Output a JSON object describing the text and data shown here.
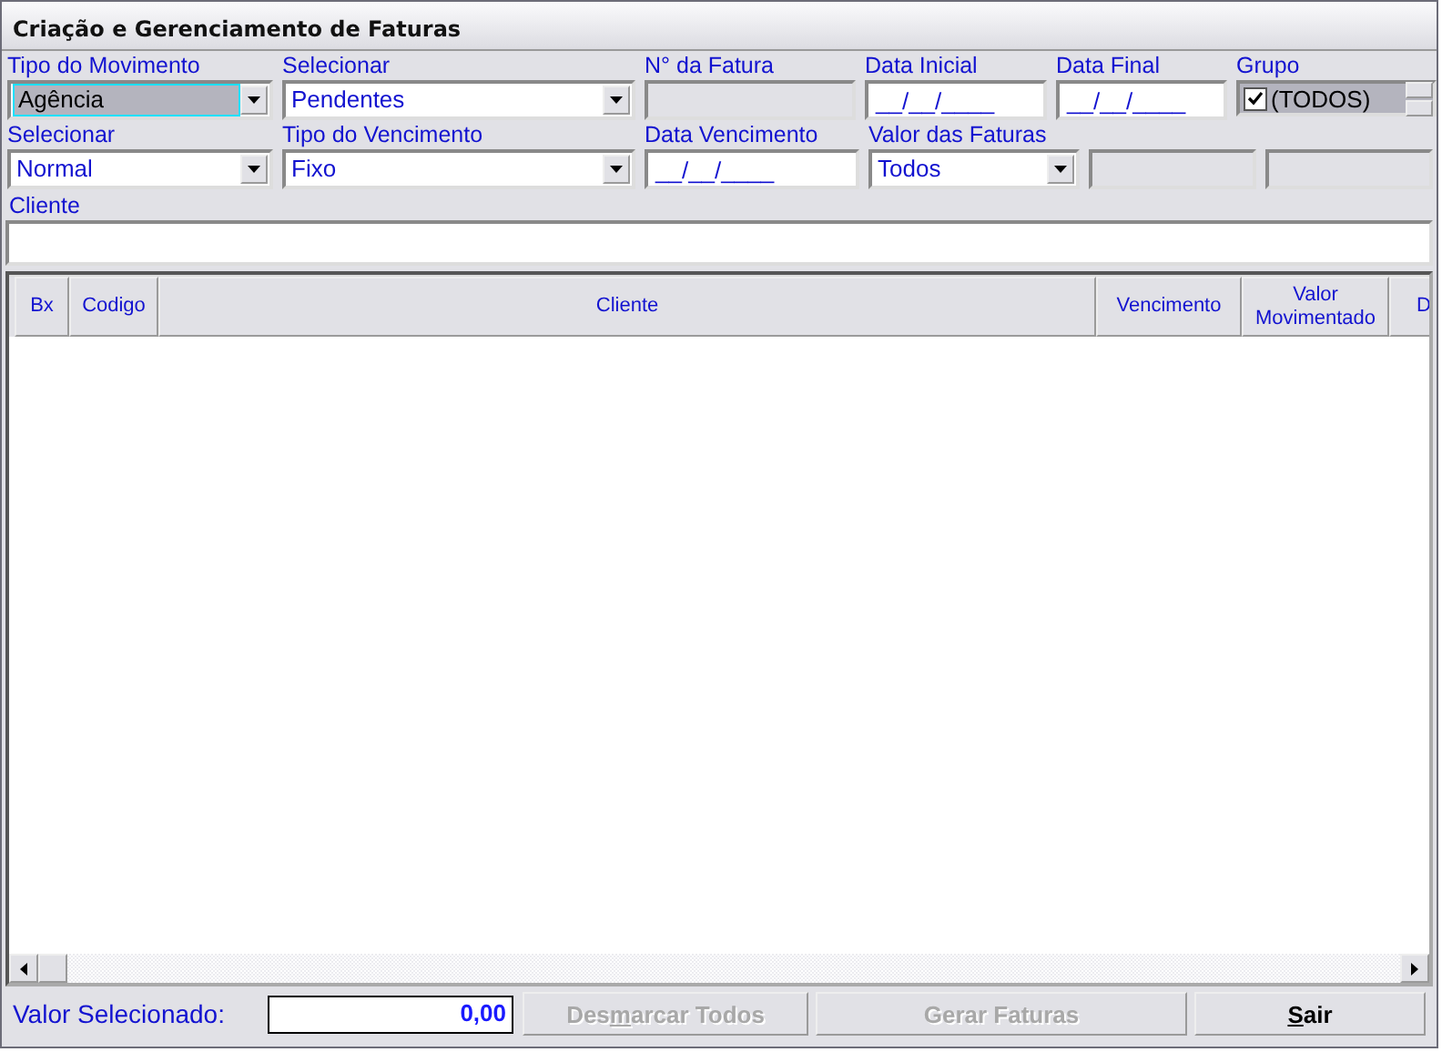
{
  "window": {
    "title": "Criação e Gerenciamento de Faturas"
  },
  "row1": [
    {
      "kind": "combo",
      "label": "Tipo do Movimento",
      "value": "Agência",
      "focused": true
    },
    {
      "kind": "combo",
      "label": "Selecionar",
      "value": "Pendentes",
      "focused": false
    },
    {
      "kind": "readonly",
      "label": "N° da Fatura"
    },
    {
      "kind": "text",
      "label": "Data Inicial",
      "value": "__/__/____"
    },
    {
      "kind": "text",
      "label": "Data Final",
      "value": "__/__/____"
    },
    {
      "kind": "check",
      "label": "Grupo",
      "value": "(TODOS)",
      "checked": true
    }
  ],
  "row2": [
    {
      "kind": "combo",
      "label": "Selecionar",
      "value": "Normal",
      "focused": false
    },
    {
      "kind": "combo",
      "label": "Tipo do Vencimento",
      "value": "Fixo",
      "focused": false
    },
    {
      "kind": "text",
      "label": "Data Vencimento",
      "value": "__/__/____"
    },
    {
      "kind": "combo",
      "label": "Valor das Faturas",
      "value": "Todos",
      "focused": false
    },
    {
      "kind": "readonly"
    },
    {
      "kind": "readonly"
    }
  ],
  "cliente": {
    "label": "Cliente"
  },
  "table": {
    "columns": [
      "Bx",
      "Codigo",
      "Cliente",
      "Vencimento",
      "Valor Movimentado",
      "D"
    ]
  },
  "footer": {
    "label": "Valor Selecionado:",
    "value": "0,00",
    "buttons": [
      {
        "label": "Des",
        "access_key": "m",
        "label_rest": "arcar Todos",
        "disabled": true
      },
      {
        "label": "Gerar Faturas",
        "disabled": true
      },
      {
        "access_key": "S",
        "label_rest": "air",
        "disabled": false
      }
    ]
  }
}
